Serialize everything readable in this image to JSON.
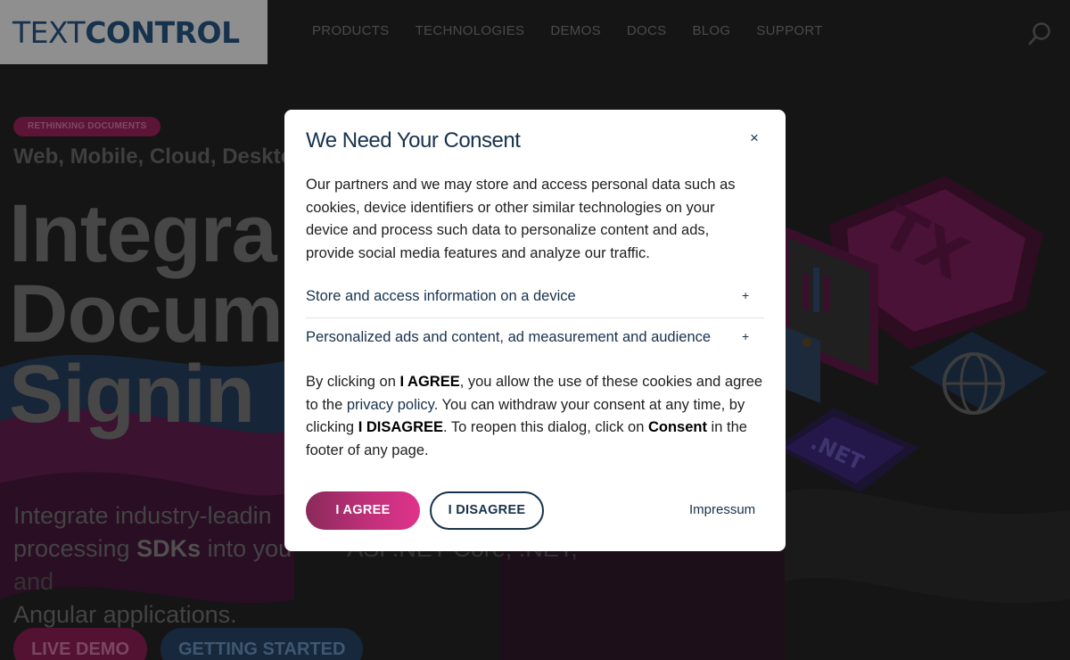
{
  "header": {
    "logo_light": "TEXT",
    "logo_bold": "CONTROL",
    "nav": [
      "PRODUCTS",
      "TECHNOLOGIES",
      "DEMOS",
      "DOCS",
      "BLOG",
      "SUPPORT"
    ]
  },
  "hero": {
    "badge": "RETHINKING DOCUMENTS",
    "tagline": "Web, Mobile, Cloud, Deskto",
    "big1": "Integra",
    "big2": "Docum",
    "big3": "Signin",
    "desc_line1": "Integrate industry-leadin",
    "desc_line2_a": "processing ",
    "desc_line2_b": "SDKs",
    "desc_line2_c": " into you",
    "desc_line3": "Angular applications.",
    "desc_right": "ASP.NET Core, .NET, and",
    "btn_live": "LIVE DEMO",
    "btn_start": "GETTING STARTED",
    "art_text_tx": "TX",
    "art_text_net": ".NET"
  },
  "modal": {
    "title": "We Need Your Consent",
    "close": "×",
    "body": "Our partners and we may store and access personal data such as cookies, device identifiers or other similar technologies on your device and process such data to personalize content and ads, provide social media features and analyze our traffic.",
    "accordion": [
      {
        "label": "Store and access information on a device",
        "icon": "+"
      },
      {
        "label": "Personalized ads and content, ad measurement and audience",
        "icon": "+"
      }
    ],
    "note": {
      "p1": "By clicking on ",
      "agree_word": "I AGREE",
      "p2": ", you allow the use of these cookies and agree to the ",
      "privacy_link": "privacy policy",
      "p3": ". You can withdraw your consent at any time, by clicking ",
      "disagree_word": "I DISAGREE",
      "p4": ". To reopen this dialog, click on ",
      "consent_word": "Consent",
      "p5": " in the footer of any page."
    },
    "agree_button": "I AGREE",
    "disagree_button": "I DISAGREE",
    "impressum": "Impressum"
  },
  "colors": {
    "navy": "#17324d",
    "magenta": "#e0338a",
    "overlay_bg": "#151515"
  }
}
